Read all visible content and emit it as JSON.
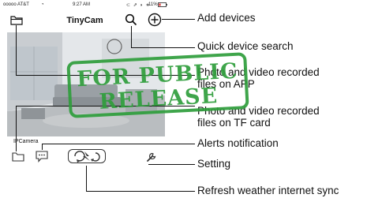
{
  "status_bar": {
    "carrier": "ooooo AT&T",
    "time": "9:27 AM",
    "battery": "11%"
  },
  "app_bar": {
    "title": "TinyCam"
  },
  "camera": {
    "label": "IPCamera"
  },
  "annotations": {
    "add_devices": "Add devices",
    "quick_search": "Quick device search",
    "app_files_line1": "Photo and video recorded",
    "app_files_line2": "files on APP",
    "tf_files_line1": "Photo and video recorded",
    "tf_files_line2": "files on TF card",
    "alerts": "Alerts notification",
    "setting": "Setting",
    "refresh": "Refresh weather internet sync"
  },
  "watermark": {
    "line1": "FOR PUBLIC",
    "line2": "RELEASE"
  },
  "colors": {
    "watermark_green": "#2f9e3c",
    "text": "#111111"
  }
}
